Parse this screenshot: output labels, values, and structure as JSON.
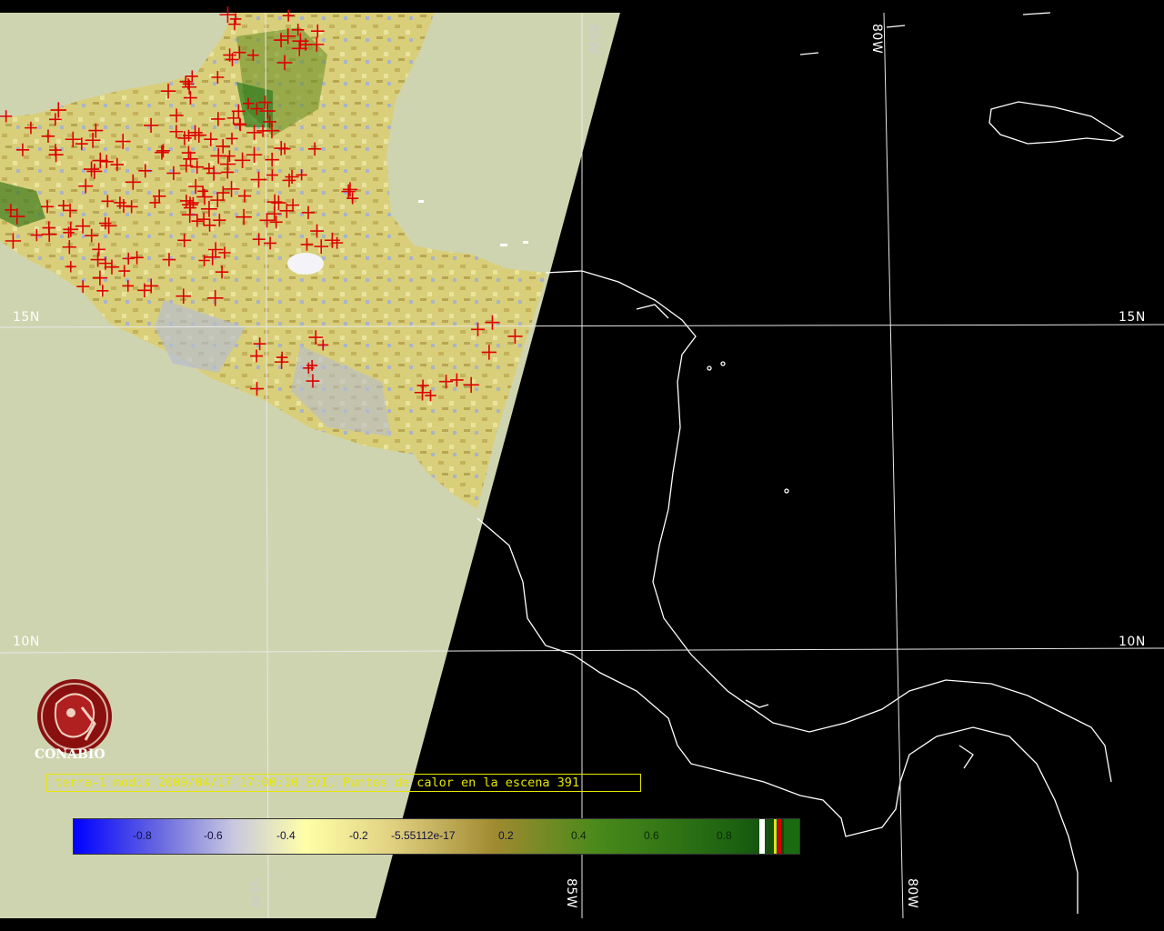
{
  "caption": "terra-1 modis 2009/04/17 17:00:10 EVI, Puntos de calor en la escena 391",
  "logo": {
    "text": "CONABIO"
  },
  "grid_labels": {
    "lat_15_left": "15N",
    "lat_15_right": "15N",
    "lat_10_left": "10N",
    "lat_10_right": "10N",
    "lon_85_top": "85W",
    "lon_80_top": "80W",
    "lon_90_bottom": "90W",
    "lon_85_bottom": "85W",
    "lon_80_bottom": "80W"
  },
  "colorbar": {
    "ticks": [
      "-0.8",
      "-0.6",
      "-0.4",
      "-0.2",
      "-5.55112e-17",
      "0.2",
      "0.4",
      "0.6",
      "0.8"
    ],
    "colors": {
      "low": "#0000ff",
      "mid": "#ffffa0",
      "high": "#1f6a10",
      "hotspot": "#cc0000"
    }
  },
  "hotspot_count": 391,
  "colors": {
    "scene_background": "#cfd4b0",
    "night": "#000000",
    "coastline": "#ffffff",
    "hotspot": "#dd0000"
  }
}
